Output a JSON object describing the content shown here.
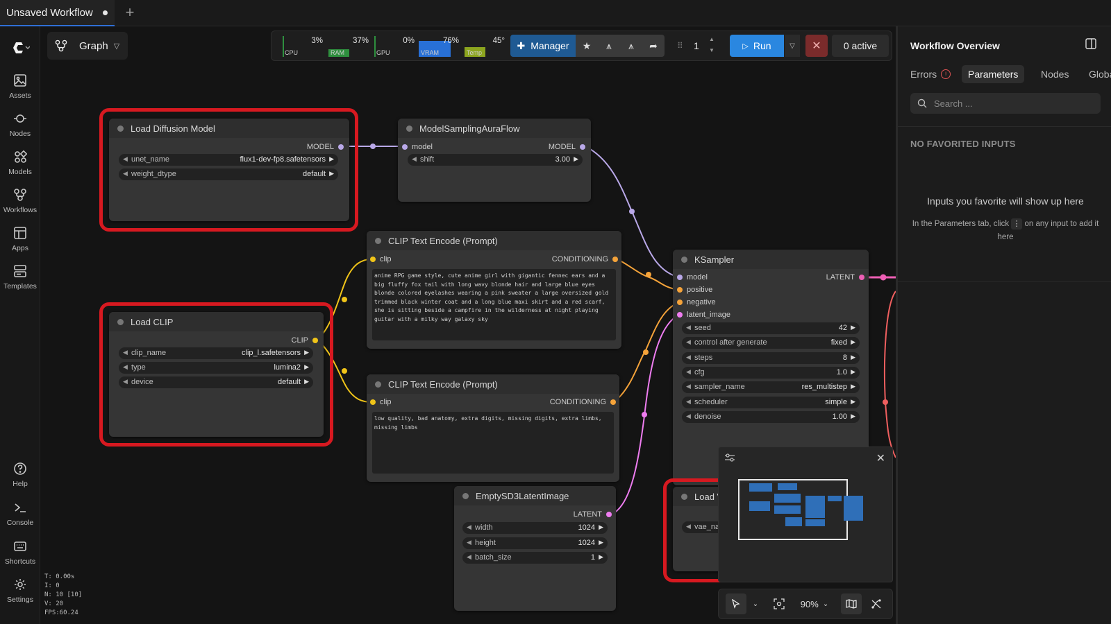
{
  "tab": {
    "title": "Unsaved Workflow"
  },
  "sidebar": {
    "items": [
      {
        "label": "Assets"
      },
      {
        "label": "Nodes"
      },
      {
        "label": "Models"
      },
      {
        "label": "Workflows"
      },
      {
        "label": "Apps"
      },
      {
        "label": "Templates"
      },
      {
        "label": "Help"
      },
      {
        "label": "Console"
      },
      {
        "label": "Shortcuts"
      },
      {
        "label": "Settings"
      }
    ]
  },
  "graph_button": {
    "label": "Graph"
  },
  "monitors": [
    {
      "name": "CPU",
      "value": "3%",
      "level": 0.03,
      "color": "#2e8f3e"
    },
    {
      "name": "RAM",
      "value": "37%",
      "level": 0.37,
      "color": "#2e8f3e"
    },
    {
      "name": "GPU",
      "value": "0%",
      "level": 0.0,
      "color": "#2e8f3e"
    },
    {
      "name": "VRAM",
      "value": "76%",
      "level": 0.76,
      "color": "#2870d6"
    },
    {
      "name": "Temp",
      "value": "45°",
      "level": 0.45,
      "color": "#8ca51f"
    }
  ],
  "toolbar": {
    "manager_label": "Manager",
    "batch_count": "1",
    "run_label": "Run",
    "active_label": "0 active"
  },
  "nodes": {
    "load_diffusion": {
      "title": "Load Diffusion Model",
      "output": "MODEL",
      "widgets": [
        {
          "label": "unet_name",
          "value": "flux1-dev-fp8.safetensors"
        },
        {
          "label": "weight_dtype",
          "value": "default"
        }
      ]
    },
    "model_sampling": {
      "title": "ModelSamplingAuraFlow",
      "input": "model",
      "output": "MODEL",
      "widgets": [
        {
          "label": "shift",
          "value": "3.00"
        }
      ]
    },
    "clip_pos": {
      "title": "CLIP Text Encode (Prompt)",
      "input": "clip",
      "output": "CONDITIONING",
      "text": "anime RPG game style, cute anime girl with gigantic fennec ears and a big fluffy fox tail with long wavy blonde hair and large blue eyes blonde colored eyelashes wearing a pink sweater a large oversized gold trimmed black winter coat and a long blue maxi skirt and a red scarf, she is sitting beside a campfire in the wilderness at night playing guitar with a milky way galaxy sky"
    },
    "clip_neg": {
      "title": "CLIP Text Encode (Prompt)",
      "input": "clip",
      "output": "CONDITIONING",
      "text": "low quality, bad anatomy, extra digits, missing digits, extra limbs, missing limbs"
    },
    "load_clip": {
      "title": "Load CLIP",
      "output": "CLIP",
      "widgets": [
        {
          "label": "clip_name",
          "value": "clip_l.safetensors"
        },
        {
          "label": "type",
          "value": "lumina2"
        },
        {
          "label": "device",
          "value": "default"
        }
      ]
    },
    "ksampler": {
      "title": "KSampler",
      "inputs": [
        "model",
        "positive",
        "negative",
        "latent_image"
      ],
      "output": "LATENT",
      "widgets": [
        {
          "label": "seed",
          "value": "42"
        },
        {
          "label": "control after generate",
          "value": "fixed"
        },
        {
          "label": "steps",
          "value": "8"
        },
        {
          "label": "cfg",
          "value": "1.0"
        },
        {
          "label": "sampler_name",
          "value": "res_multistep"
        },
        {
          "label": "scheduler",
          "value": "simple"
        },
        {
          "label": "denoise",
          "value": "1.00"
        }
      ]
    },
    "empty_latent": {
      "title": "EmptySD3LatentImage",
      "output": "LATENT",
      "widgets": [
        {
          "label": "width",
          "value": "1024"
        },
        {
          "label": "height",
          "value": "1024"
        },
        {
          "label": "batch_size",
          "value": "1"
        }
      ]
    },
    "load_vae": {
      "title": "Load V",
      "widget_label": "vae_na"
    }
  },
  "canvas_controls": {
    "zoom": "90%"
  },
  "stats": {
    "lines": [
      "T: 0.00s",
      "I: 0",
      "N: 10 [10]",
      "V: 20",
      "FPS:60.24"
    ]
  },
  "right_panel": {
    "title": "Workflow Overview",
    "tabs": [
      "Errors",
      "Parameters",
      "Nodes",
      "Globa"
    ],
    "search_placeholder": "Search ...",
    "no_favorites": "NO FAVORITED INPUTS",
    "empty_title": "Inputs you favorite will show up here",
    "empty_hint_before": "In the Parameters tab, click",
    "empty_hint_after": "on any input to add it here"
  }
}
